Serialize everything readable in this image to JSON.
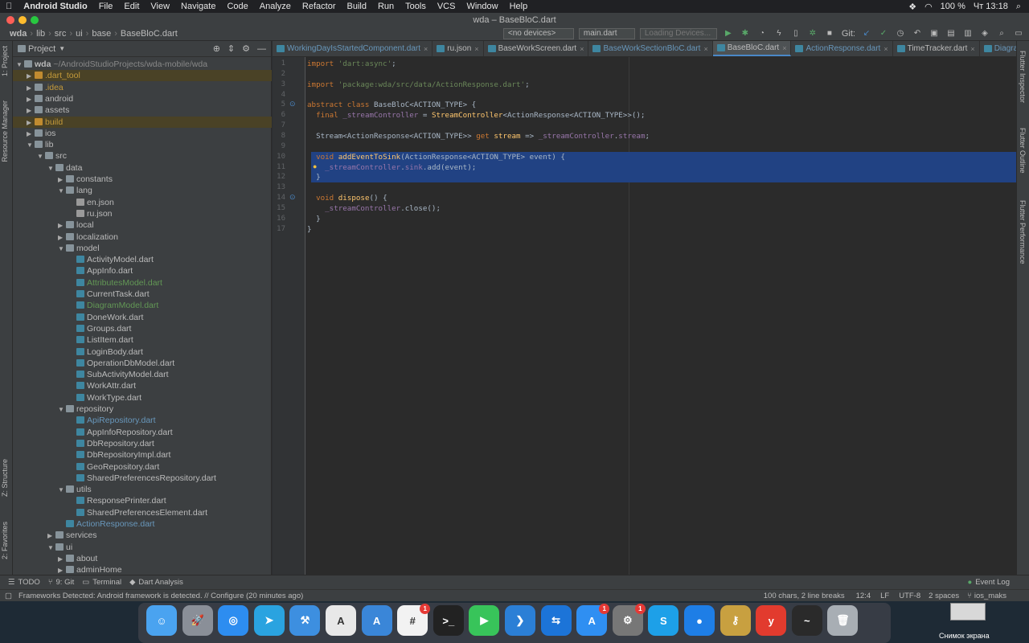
{
  "menubar": {
    "app": "Android Studio",
    "items": [
      "File",
      "Edit",
      "View",
      "Navigate",
      "Code",
      "Analyze",
      "Refactor",
      "Build",
      "Run",
      "Tools",
      "VCS",
      "Window",
      "Help"
    ],
    "battery": "100 %",
    "clock": "Чт 13:18"
  },
  "window": {
    "title": "wda – BaseBloC.dart"
  },
  "navbar": {
    "breadcrumbs": [
      "wda",
      "lib",
      "src",
      "ui",
      "base",
      "BaseBloC.dart"
    ],
    "device": "<no devices>",
    "run_config": "main.dart",
    "loading": "Loading Devices...",
    "git_label": "Git:"
  },
  "left_strip": {
    "project": "1: Project",
    "resource": "Resource Manager",
    "structure": "Z: Structure",
    "favorites": "2: Favorites"
  },
  "right_strip": {
    "inspector": "Flutter Inspector",
    "outline": "Flutter Outline",
    "performance": "Flutter Performance"
  },
  "project_panel": {
    "title": "Project",
    "tree": [
      {
        "label": "wda",
        "extra": " ~/AndroidStudioProjects/wda-mobile/wda",
        "depth": 0,
        "arrow": "▼",
        "icon": "folder",
        "color": "#bbbbbb",
        "bold": true
      },
      {
        "label": ".dart_tool",
        "depth": 1,
        "arrow": "▶",
        "icon": "ofolder",
        "color": "#c49a3a",
        "hl": true
      },
      {
        "label": ".idea",
        "depth": 1,
        "arrow": "▶",
        "icon": "folder",
        "color": "#c49a3a"
      },
      {
        "label": "android",
        "depth": 1,
        "arrow": "▶",
        "icon": "folder",
        "color": "#bbbbbb"
      },
      {
        "label": "assets",
        "depth": 1,
        "arrow": "▶",
        "icon": "folder",
        "color": "#bbbbbb"
      },
      {
        "label": "build",
        "depth": 1,
        "arrow": "▶",
        "icon": "ofolder",
        "color": "#c49a3a",
        "hl": true
      },
      {
        "label": "ios",
        "depth": 1,
        "arrow": "▶",
        "icon": "folder",
        "color": "#bbbbbb"
      },
      {
        "label": "lib",
        "depth": 1,
        "arrow": "▼",
        "icon": "folder",
        "color": "#bbbbbb"
      },
      {
        "label": "src",
        "depth": 2,
        "arrow": "▼",
        "icon": "folder",
        "color": "#bbbbbb"
      },
      {
        "label": "data",
        "depth": 3,
        "arrow": "▼",
        "icon": "folder",
        "color": "#bbbbbb"
      },
      {
        "label": "constants",
        "depth": 4,
        "arrow": "▶",
        "icon": "folder",
        "color": "#bbbbbb"
      },
      {
        "label": "lang",
        "depth": 4,
        "arrow": "▼",
        "icon": "folder",
        "color": "#bbbbbb"
      },
      {
        "label": "en.json",
        "depth": 5,
        "arrow": "",
        "icon": "json",
        "color": "#bbbbbb"
      },
      {
        "label": "ru.json",
        "depth": 5,
        "arrow": "",
        "icon": "json",
        "color": "#bbbbbb"
      },
      {
        "label": "local",
        "depth": 4,
        "arrow": "▶",
        "icon": "folder",
        "color": "#bbbbbb"
      },
      {
        "label": "localization",
        "depth": 4,
        "arrow": "▶",
        "icon": "folder",
        "color": "#bbbbbb"
      },
      {
        "label": "model",
        "depth": 4,
        "arrow": "▼",
        "icon": "folder",
        "color": "#bbbbbb"
      },
      {
        "label": "ActivityModel.dart",
        "depth": 5,
        "arrow": "",
        "icon": "dart",
        "color": "#bbbbbb"
      },
      {
        "label": "AppInfo.dart",
        "depth": 5,
        "arrow": "",
        "icon": "dart",
        "color": "#bbbbbb"
      },
      {
        "label": "AttributesModel.dart",
        "depth": 5,
        "arrow": "",
        "icon": "dart",
        "color": "#629755"
      },
      {
        "label": "CurrentTask.dart",
        "depth": 5,
        "arrow": "",
        "icon": "dart",
        "color": "#bbbbbb"
      },
      {
        "label": "DiagramModel.dart",
        "depth": 5,
        "arrow": "",
        "icon": "dart",
        "color": "#629755"
      },
      {
        "label": "DoneWork.dart",
        "depth": 5,
        "arrow": "",
        "icon": "dart",
        "color": "#bbbbbb"
      },
      {
        "label": "Groups.dart",
        "depth": 5,
        "arrow": "",
        "icon": "dart",
        "color": "#bbbbbb"
      },
      {
        "label": "ListItem.dart",
        "depth": 5,
        "arrow": "",
        "icon": "dart",
        "color": "#bbbbbb"
      },
      {
        "label": "LoginBody.dart",
        "depth": 5,
        "arrow": "",
        "icon": "dart",
        "color": "#bbbbbb"
      },
      {
        "label": "OperationDbModel.dart",
        "depth": 5,
        "arrow": "",
        "icon": "dart",
        "color": "#bbbbbb"
      },
      {
        "label": "SubActivityModel.dart",
        "depth": 5,
        "arrow": "",
        "icon": "dart",
        "color": "#bbbbbb"
      },
      {
        "label": "WorkAttr.dart",
        "depth": 5,
        "arrow": "",
        "icon": "dart",
        "color": "#bbbbbb"
      },
      {
        "label": "WorkType.dart",
        "depth": 5,
        "arrow": "",
        "icon": "dart",
        "color": "#bbbbbb"
      },
      {
        "label": "repository",
        "depth": 4,
        "arrow": "▼",
        "icon": "folder",
        "color": "#bbbbbb"
      },
      {
        "label": "ApiRepository.dart",
        "depth": 5,
        "arrow": "",
        "icon": "dart",
        "color": "#6897bb"
      },
      {
        "label": "AppInfoRepository.dart",
        "depth": 5,
        "arrow": "",
        "icon": "dart",
        "color": "#bbbbbb"
      },
      {
        "label": "DbRepository.dart",
        "depth": 5,
        "arrow": "",
        "icon": "dart",
        "color": "#bbbbbb"
      },
      {
        "label": "DbRepositoryImpl.dart",
        "depth": 5,
        "arrow": "",
        "icon": "dart",
        "color": "#bbbbbb"
      },
      {
        "label": "GeoRepository.dart",
        "depth": 5,
        "arrow": "",
        "icon": "dart",
        "color": "#bbbbbb"
      },
      {
        "label": "SharedPreferencesRepository.dart",
        "depth": 5,
        "arrow": "",
        "icon": "dart",
        "color": "#bbbbbb"
      },
      {
        "label": "utils",
        "depth": 4,
        "arrow": "▼",
        "icon": "folder",
        "color": "#bbbbbb"
      },
      {
        "label": "ResponsePrinter.dart",
        "depth": 5,
        "arrow": "",
        "icon": "dart",
        "color": "#bbbbbb"
      },
      {
        "label": "SharedPreferencesElement.dart",
        "depth": 5,
        "arrow": "",
        "icon": "dart",
        "color": "#bbbbbb"
      },
      {
        "label": "ActionResponse.dart",
        "depth": 4,
        "arrow": "",
        "icon": "dart",
        "color": "#6897bb"
      },
      {
        "label": "services",
        "depth": 3,
        "arrow": "▶",
        "icon": "folder",
        "color": "#bbbbbb"
      },
      {
        "label": "ui",
        "depth": 3,
        "arrow": "▼",
        "icon": "folder",
        "color": "#bbbbbb"
      },
      {
        "label": "about",
        "depth": 4,
        "arrow": "▶",
        "icon": "folder",
        "color": "#bbbbbb"
      },
      {
        "label": "adminHome",
        "depth": 4,
        "arrow": "▶",
        "icon": "folder",
        "color": "#bbbbbb"
      }
    ]
  },
  "tabs": [
    {
      "label": "WorkingDayIsStartedComponent.dart",
      "active": false,
      "color": "#6897bb"
    },
    {
      "label": "ru.json",
      "active": false,
      "color": "#bbbbbb"
    },
    {
      "label": "BaseWorkScreen.dart",
      "active": false,
      "color": "#bbbbbb"
    },
    {
      "label": "BaseWorkSectionBloC.dart",
      "active": false,
      "color": "#6897bb"
    },
    {
      "label": "BaseBloC.dart",
      "active": true,
      "color": "#bbbbbb"
    },
    {
      "label": "ActionResponse.dart",
      "active": false,
      "color": "#6897bb"
    },
    {
      "label": "TimeTracker.dart",
      "active": false,
      "color": "#bbbbbb"
    },
    {
      "label": "DiagramPage",
      "active": false,
      "color": "#6897bb"
    }
  ],
  "code_lines": [
    {
      "n": "1",
      "html": "<span class='kw'>import </span><span class='str'>'dart:async'</span>;"
    },
    {
      "n": "2",
      "html": ""
    },
    {
      "n": "3",
      "html": "<span class='kw'>import </span><span class='str'>'package:wda/src/data/ActionResponse.dart'</span>;"
    },
    {
      "n": "4",
      "html": ""
    },
    {
      "n": "5",
      "html": "<span class='kw'>abstract class </span>BaseBloC&lt;ACTION_TYPE&gt; {"
    },
    {
      "n": "6",
      "html": "  <span class='kw'>final </span><span class='fld'>_streamController</span> = <span class='fn'>StreamController</span>&lt;ActionResponse&lt;ACTION_TYPE&gt;&gt;();"
    },
    {
      "n": "7",
      "html": ""
    },
    {
      "n": "8",
      "html": "  Stream&lt;ActionResponse&lt;ACTION_TYPE&gt;&gt; <span class='kw'>get </span><span class='fn'>stream</span> =&gt; <span class='fld'>_streamController</span>.<span class='fld'>stream</span>;"
    },
    {
      "n": "9",
      "html": ""
    },
    {
      "n": "10",
      "html": "  <span class='kw'>void </span><span class='fn'>addEventToSink</span>(ActionResponse&lt;ACTION_TYPE&gt; event) {",
      "sel": true
    },
    {
      "n": "11",
      "html": "    <span class='fld'>_streamController</span>.<span class='fld'>sink</span>.add(event);",
      "sel": true
    },
    {
      "n": "12",
      "html": "  }",
      "sel": true
    },
    {
      "n": "13",
      "html": ""
    },
    {
      "n": "14",
      "html": "  <span class='kw'>void </span><span class='fn'>dispose</span>() {"
    },
    {
      "n": "15",
      "html": "    <span class='fld'>_streamController</span>.close();"
    },
    {
      "n": "16",
      "html": "  }"
    },
    {
      "n": "17",
      "html": "}"
    }
  ],
  "bottom_tabs": [
    "TODO",
    "9: Git",
    "Terminal",
    "Dart Analysis"
  ],
  "event_log": "Event Log",
  "status": {
    "message": "Frameworks Detected: Android framework is detected. // Configure (20 minutes ago)",
    "chars": "100 chars, 2 line breaks",
    "position": "12:4",
    "line_sep": "LF",
    "encoding": "UTF-8",
    "indent": "2 spaces",
    "branch": "ios_maks"
  },
  "dock": {
    "apps": [
      {
        "name": "finder",
        "color": "#4aa3f0",
        "glyph": "☺"
      },
      {
        "name": "launchpad",
        "color": "#8a8f98",
        "glyph": "🚀"
      },
      {
        "name": "safari",
        "color": "#2d8df0",
        "glyph": "◎"
      },
      {
        "name": "telegram",
        "color": "#2aa3e0",
        "glyph": "➤"
      },
      {
        "name": "xcode",
        "color": "#3d8fe0",
        "glyph": "⚒"
      },
      {
        "name": "android-studio",
        "color": "#e8e8e8",
        "glyph": "A"
      },
      {
        "name": "simulator",
        "color": "#3a86d8",
        "glyph": "A"
      },
      {
        "name": "slack",
        "color": "#f2f2f2",
        "glyph": "#",
        "badge": "1"
      },
      {
        "name": "terminal",
        "color": "#222",
        "glyph": ">_"
      },
      {
        "name": "facetime",
        "color": "#38c45a",
        "glyph": "▶"
      },
      {
        "name": "vscode",
        "color": "#2b7fd6",
        "glyph": "❯"
      },
      {
        "name": "teamviewer",
        "color": "#1c74d8",
        "glyph": "⇆"
      },
      {
        "name": "app-store",
        "color": "#2f8ff2",
        "glyph": "A",
        "badge": "1"
      },
      {
        "name": "system-preferences",
        "color": "#777",
        "glyph": "⚙",
        "badge": "1"
      },
      {
        "name": "skype",
        "color": "#1da0e8",
        "glyph": "S"
      },
      {
        "name": "maps-pin",
        "color": "#1e7ee6",
        "glyph": "●"
      },
      {
        "name": "keychain",
        "color": "#c8a040",
        "glyph": "⚷"
      },
      {
        "name": "warning-app",
        "color": "#e23b2e",
        "glyph": "y"
      },
      {
        "name": "activity-monitor",
        "color": "#2a2a2a",
        "glyph": "~"
      },
      {
        "name": "trash",
        "color": "#a8aeb4",
        "glyph": "🗑"
      }
    ]
  },
  "desktop_label": "Снимок экрана"
}
